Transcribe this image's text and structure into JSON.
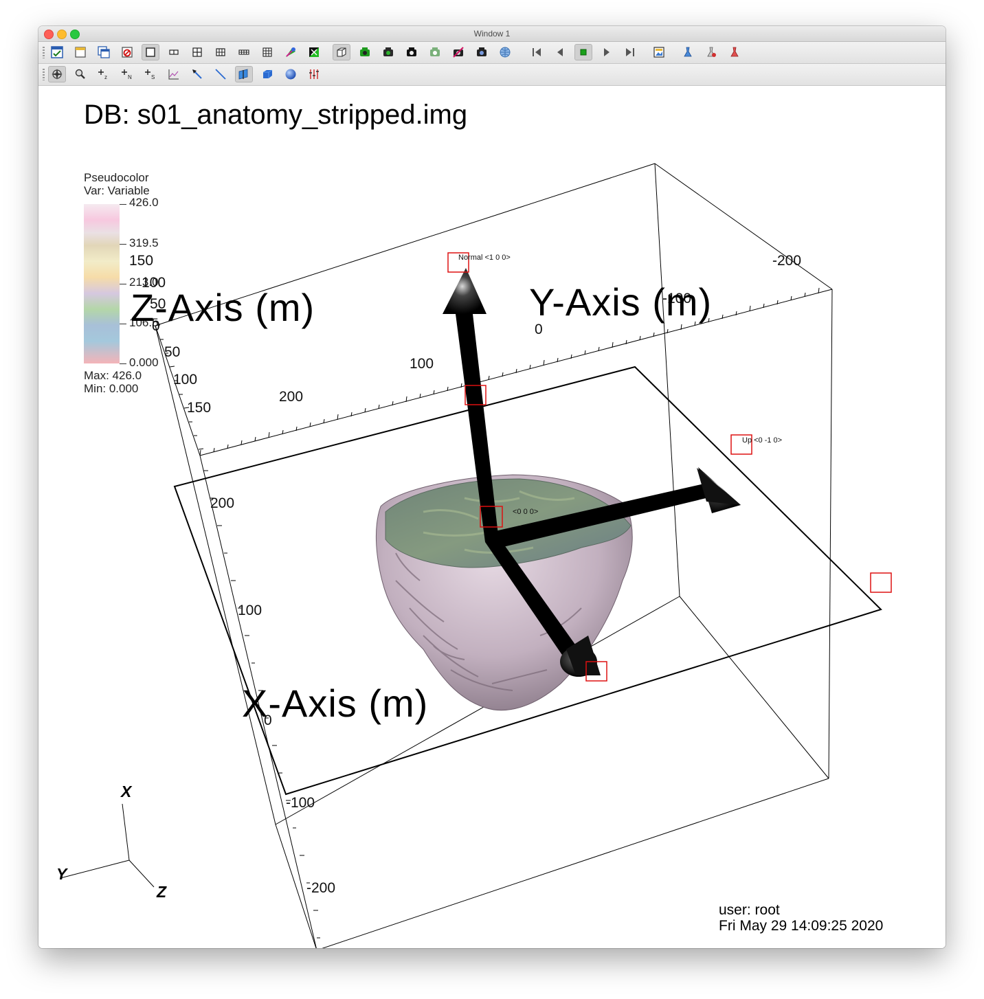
{
  "window": {
    "title": "Window 1"
  },
  "toolbar1": {
    "icons": [
      "active-window-icon",
      "new-window-icon",
      "clone-window-icon",
      "delete-window-icon",
      "layout-1x1-icon",
      "layout-1x2-icon",
      "layout-2x2-icon",
      "layout-2x3-icon",
      "layout-2x4-icon",
      "layout-3x3-icon",
      "clear-plots-icon",
      "lock-view-icon",
      "3d-box-icon",
      "camera-green-icon",
      "camera-save-icon",
      "camera-icon",
      "camera-light-icon",
      "camera-red-icon",
      "camera-dark-icon",
      "globe-icon",
      "skip-back-icon",
      "step-back-icon",
      "stop-icon",
      "play-icon",
      "skip-forward-icon",
      "image-icon",
      "tool-a-icon",
      "tool-b-icon",
      "tool-c-icon"
    ]
  },
  "toolbar2": {
    "icons": [
      "navigate-icon",
      "zoom-icon",
      "pick-z-icon",
      "pick-n-icon",
      "pick-s-icon",
      "lineout-icon",
      "point-tool-icon",
      "line-tool-icon",
      "plane-tool-icon",
      "box-tool-icon",
      "sphere-tool-icon",
      "axis-restrict-icon"
    ]
  },
  "plot": {
    "db_title": "DB: s01_anatomy_stripped.img",
    "legend": {
      "title": "Pseudocolor",
      "var": "Var: Variable",
      "max_label": "Max:  426.0",
      "min_label": "Min:  0.000",
      "ticks": [
        "426.0",
        "319.5",
        "213.0",
        "106.5",
        "0.000"
      ]
    },
    "axes": {
      "z_title": "Z-Axis (m)",
      "y_title": "Y-Axis (m)",
      "x_title": "X-Axis (m)",
      "z_ticks": [
        "150",
        "100",
        "50",
        "0",
        "50",
        "100",
        "150"
      ],
      "y_ticks": [
        "-200",
        "-100",
        "0",
        "100",
        "200"
      ],
      "x_ticks": [
        "200",
        "100",
        "0",
        "-100",
        "-200"
      ]
    },
    "tool_labels": {
      "normal": "Normal <1 0 0>",
      "up": "Up <0 -1 0>",
      "origin": "<0 0 0>"
    },
    "triad": {
      "x": "X",
      "y": "Y",
      "z": "Z"
    },
    "user": "user: root",
    "date": "Fri May 29 14:09:25 2020"
  },
  "colors": {
    "marker": "#dd1111",
    "brain_surface": "#c8b8c4",
    "brain_slice": "#7e9080"
  }
}
